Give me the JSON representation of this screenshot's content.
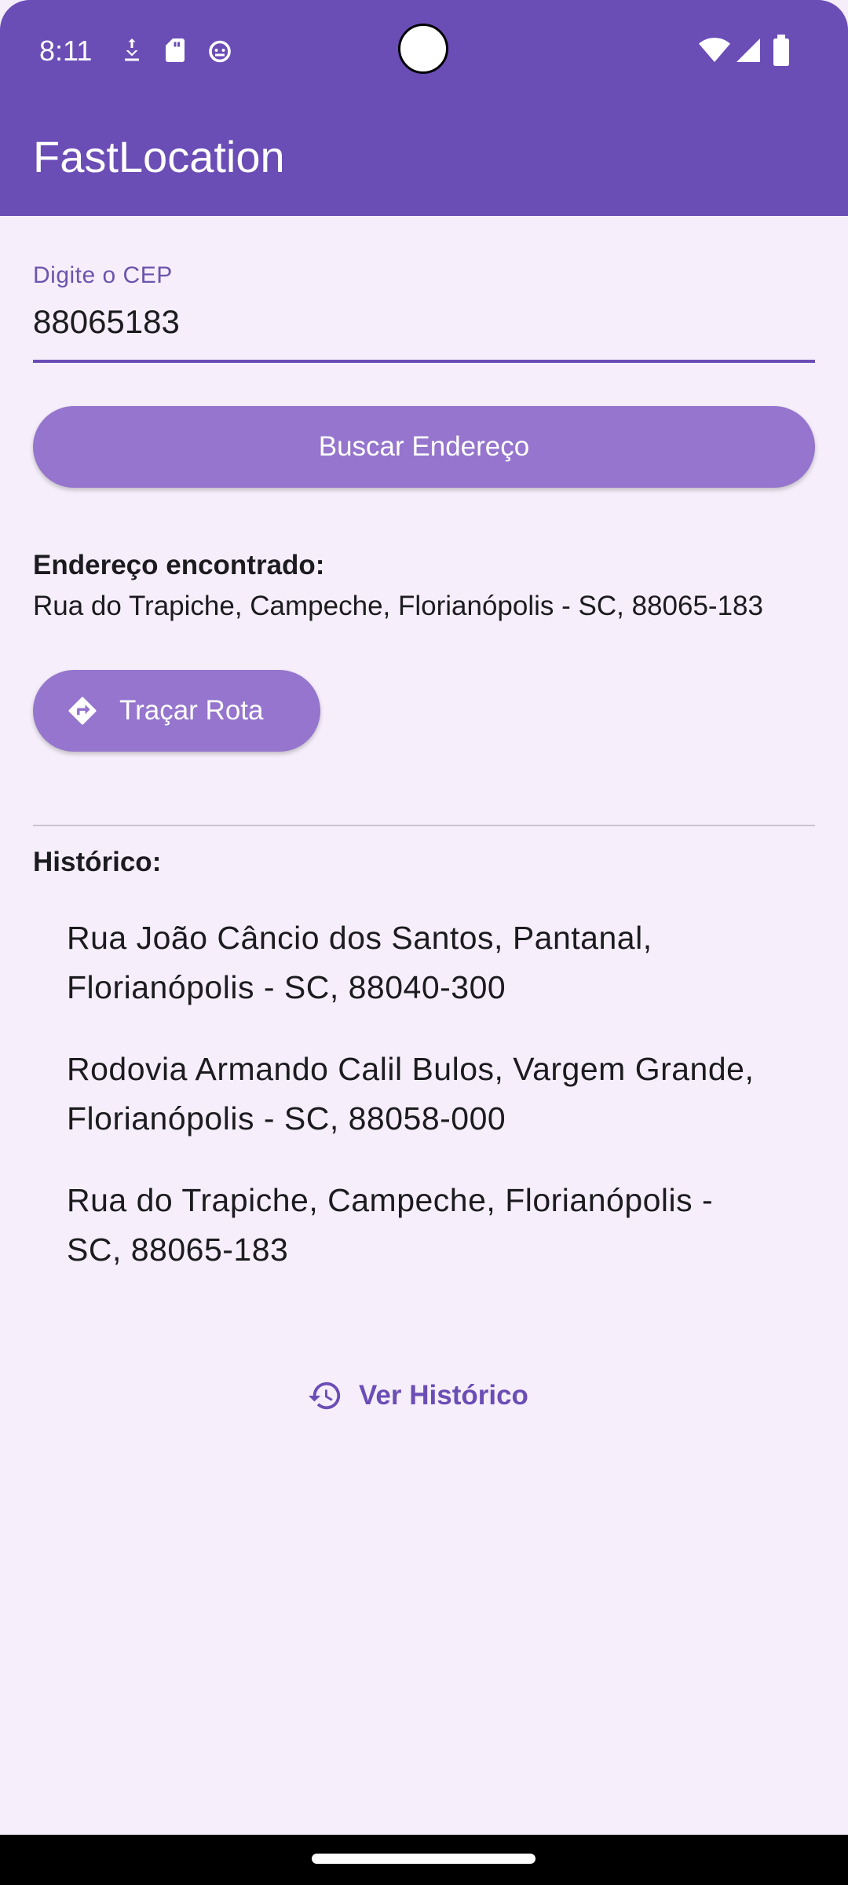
{
  "status_bar": {
    "time": "8:11",
    "icons_left": [
      "download-icon",
      "sd-card-icon",
      "android-debug-icon"
    ],
    "icons_right": [
      "wifi-icon",
      "cell-signal-icon",
      "battery-icon"
    ]
  },
  "app_bar": {
    "title": "FastLocation",
    "color": "#6b4db6"
  },
  "cep_field": {
    "label": "Digite o CEP",
    "value": "88065183"
  },
  "search_button": {
    "label": "Buscar Endereço"
  },
  "result": {
    "heading": "Endereço encontrado:",
    "address": "Rua do Trapiche, Campeche, Florianópolis - SC, 88065-183"
  },
  "route_button": {
    "label": "Traçar Rota",
    "icon": "directions-icon"
  },
  "history": {
    "heading": "Histórico:",
    "items": [
      "Rua João Câncio dos Santos, Pantanal, Florianópolis - SC, 88040-300",
      "Rodovia Armando Calil Bulos, Vargem Grande, Florianópolis - SC, 88058-000",
      "Rua do Trapiche, Campeche, Florianópolis - SC, 88065-183"
    ]
  },
  "history_link": {
    "label": "Ver Histórico",
    "icon": "history-icon"
  },
  "colors": {
    "primary": "#6b4db6",
    "button": "#9575cd",
    "background": "#f6effb"
  }
}
